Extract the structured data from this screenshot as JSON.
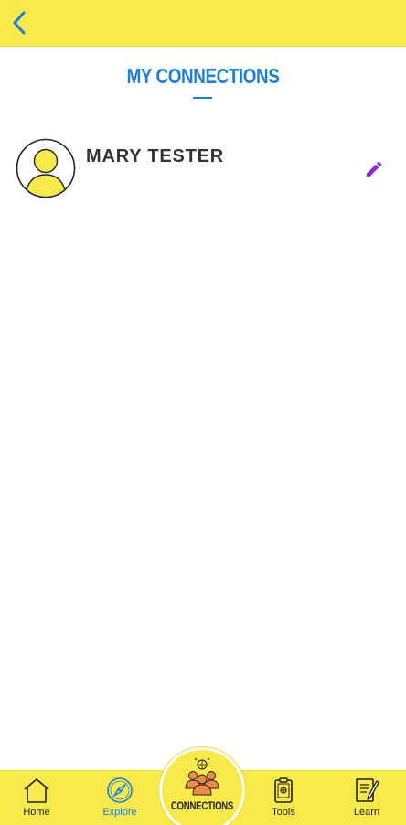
{
  "header": {
    "back_icon": "chevron-left-icon"
  },
  "page": {
    "title": "MY CONNECTIONS"
  },
  "connections": [
    {
      "name": "MARY TESTER",
      "avatar_icon": "person-avatar-icon",
      "action_icon": "pencil-icon"
    }
  ],
  "bottom_nav": {
    "items": [
      {
        "label": "Home",
        "icon": "home-icon"
      },
      {
        "label": "Explore",
        "icon": "compass-icon"
      },
      {
        "label": "CONNECTIONS",
        "icon": "people-group-icon"
      },
      {
        "label": "Tools",
        "icon": "clipboard-icon"
      },
      {
        "label": "Learn",
        "icon": "notebook-pencil-icon"
      }
    ],
    "active": "Explore"
  },
  "colors": {
    "accent_yellow": "#f7ea4a",
    "title_blue": "#1c7fd6",
    "edit_purple": "#8a2be2",
    "connections_orange": "#f08a4b"
  }
}
